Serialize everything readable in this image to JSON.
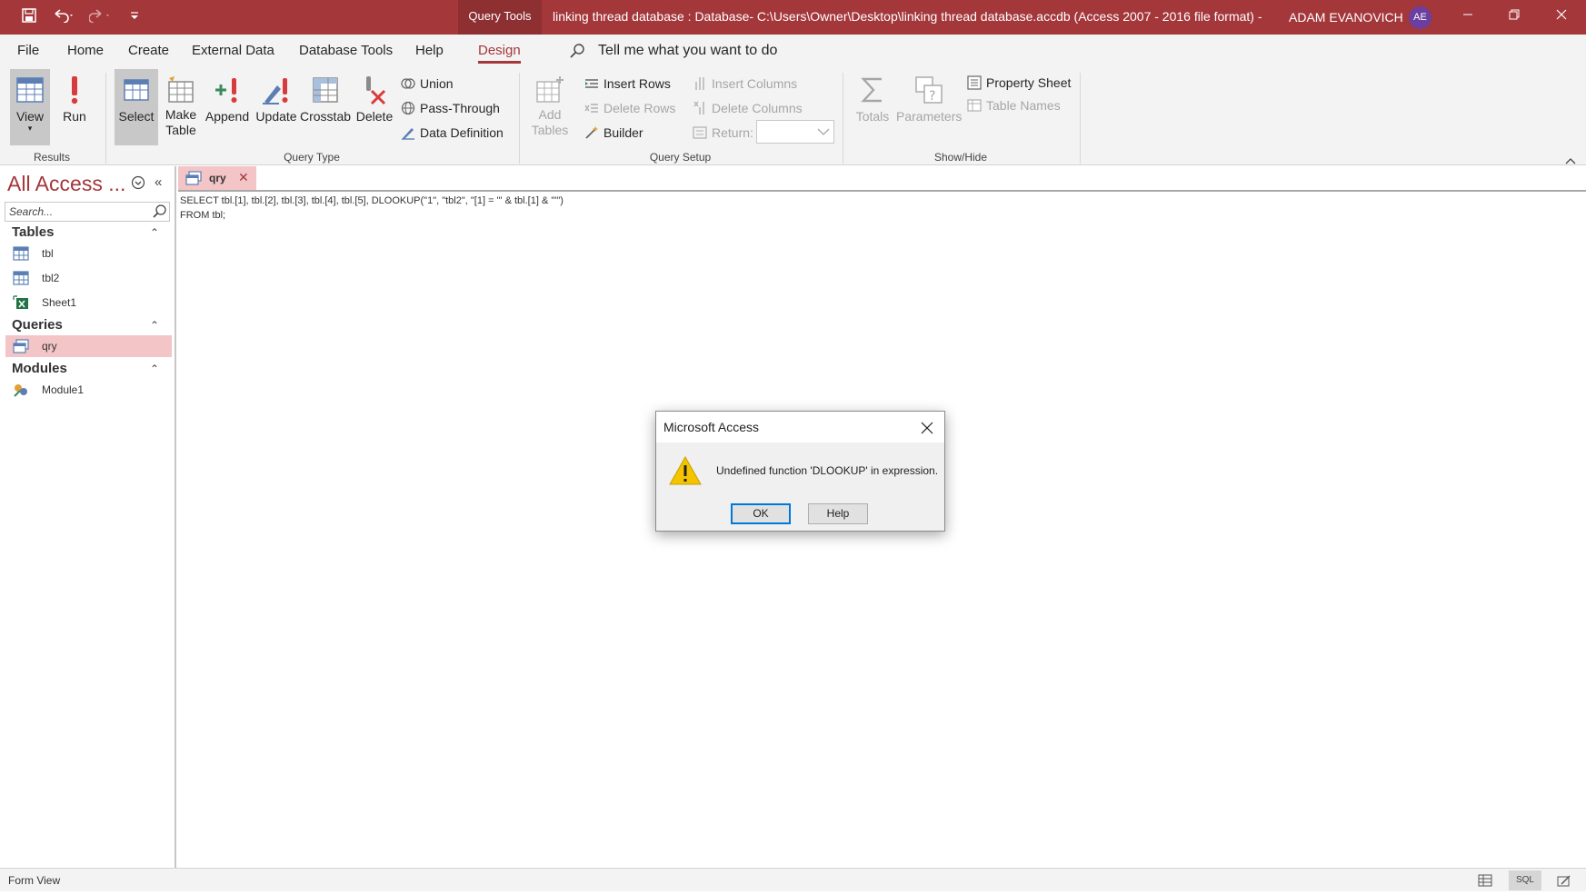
{
  "titlebar": {
    "context_tab": "Query Tools",
    "title": "linking thread database : Database- C:\\Users\\Owner\\Desktop\\linking thread database.accdb (Access 2007 - 2016 file format) -...",
    "user": "ADAM EVANOVICH",
    "initials": "AE",
    "accent": "#a4373a"
  },
  "ribbon_tabs": [
    "File",
    "Home",
    "Create",
    "External Data",
    "Database Tools",
    "Help",
    "Design"
  ],
  "tellme": "Tell me what you want to do",
  "ribbon": {
    "results": {
      "label": "Results",
      "view": "View",
      "run": "Run"
    },
    "query_type": {
      "label": "Query Type",
      "select": "Select",
      "make_table": [
        "Make",
        "Table"
      ],
      "append": "Append",
      "update": "Update",
      "crosstab": "Crosstab",
      "delete": "Delete",
      "union": "Union",
      "pass_through": "Pass-Through",
      "data_definition": "Data Definition"
    },
    "query_setup": {
      "label": "Query Setup",
      "add_tables": [
        "Add",
        "Tables"
      ],
      "insert_rows": "Insert Rows",
      "delete_rows": "Delete Rows",
      "builder": "Builder",
      "insert_columns": "Insert Columns",
      "delete_columns": "Delete Columns",
      "return": "Return:"
    },
    "show_hide": {
      "label": "Show/Hide",
      "totals": "Totals",
      "parameters": "Parameters",
      "property_sheet": "Property Sheet",
      "table_names": "Table Names"
    }
  },
  "nav": {
    "title": "All Access ...",
    "search_placeholder": "Search...",
    "sections": {
      "tables": {
        "label": "Tables",
        "items": [
          "tbl",
          "tbl2",
          "Sheet1"
        ]
      },
      "queries": {
        "label": "Queries",
        "items": [
          "qry"
        ]
      },
      "modules": {
        "label": "Modules",
        "items": [
          "Module1"
        ]
      }
    }
  },
  "document": {
    "tab": "qry",
    "sql_line1": "SELECT tbl.[1], tbl.[2], tbl.[3], tbl.[4], tbl.[5], DLOOKUP(\"1\", \"tbl2\", \"[1] = '\" & tbl.[1] & \"'\")",
    "sql_line2": "FROM tbl;"
  },
  "dialog": {
    "title": "Microsoft Access",
    "message": "Undefined function 'DLOOKUP' in expression.",
    "ok": "OK",
    "help": "Help",
    "icon": "warning-icon"
  },
  "statusbar": {
    "text": "Form View",
    "sql_view": "SQL"
  }
}
